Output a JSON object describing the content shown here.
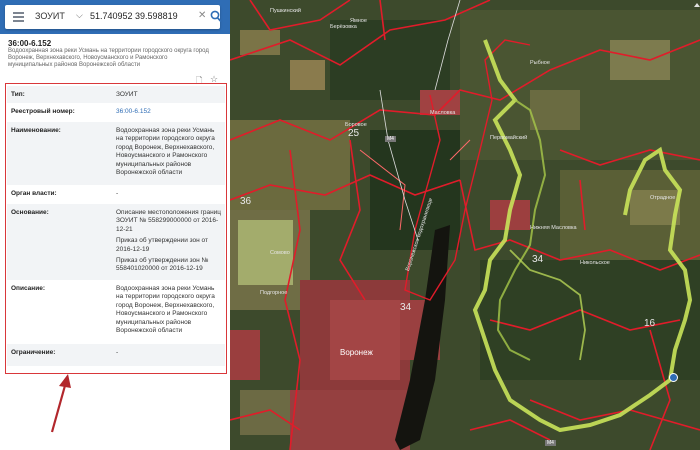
{
  "search": {
    "layer": "ЗОУИТ",
    "query": "51.740952 39.598819"
  },
  "object": {
    "number": "36:00-6.152",
    "subtitle": "Водоохранная зона реки Усмань на территории городского округа город Воронеж, Верхнехавского, Новоусманского и Рамонского муниципальных районов Воронежской области"
  },
  "attributes": {
    "type": {
      "label": "Тип:",
      "value": "ЗОУИТ"
    },
    "registry": {
      "label": "Реестровый номер:",
      "value": "36:00-6.152"
    },
    "name": {
      "label": "Наименование:",
      "value": "Водоохранная зона реки Усмань на территории городского округа город Воронеж, Верхнехавского, Новоусманского и Рамонского муниципальных районов Воронежской области"
    },
    "authority": {
      "label": "Орган власти:",
      "value": "-"
    },
    "basis": {
      "label": "Основание:",
      "value1": "Описание местоположения границ ЗОУИТ № 558299000000 от 2016-12-21",
      "value2": "Приказ об утверждении зон от 2016-12-19",
      "value3": "Приказ об утверждении зон № 558401020000 от 2016-12-19"
    },
    "description": {
      "label": "Описание:",
      "value": "Водоохранная зона реки Усмань на территории городского округа город Воронеж, Верхнехавского, Новоусманского и Рамонского муниципальных районов Воронежской области"
    },
    "restriction": {
      "label": "Ограничение:",
      "value": "-"
    }
  },
  "map": {
    "zones": [
      "36",
      "25",
      "34",
      "34",
      "16"
    ],
    "city": "Воронеж",
    "road_labels": [
      "М4",
      "М4"
    ],
    "places": [
      "Берёзовка",
      "Пушкинский",
      "Масловка",
      "Ямное",
      "Подгорное",
      "Первомайский",
      "Рыбное",
      "Боровое",
      "Отрадное",
      "Никольское",
      "Сомово",
      "Нижняя Масловка",
      "Воронежское водохранилище"
    ],
    "colors": {
      "boundary": "#e11c2a",
      "water_zone": "#c9e35a",
      "panel_border": "#d9373a",
      "search_bar": "#2f6db5",
      "link": "#2f6db5"
    }
  }
}
